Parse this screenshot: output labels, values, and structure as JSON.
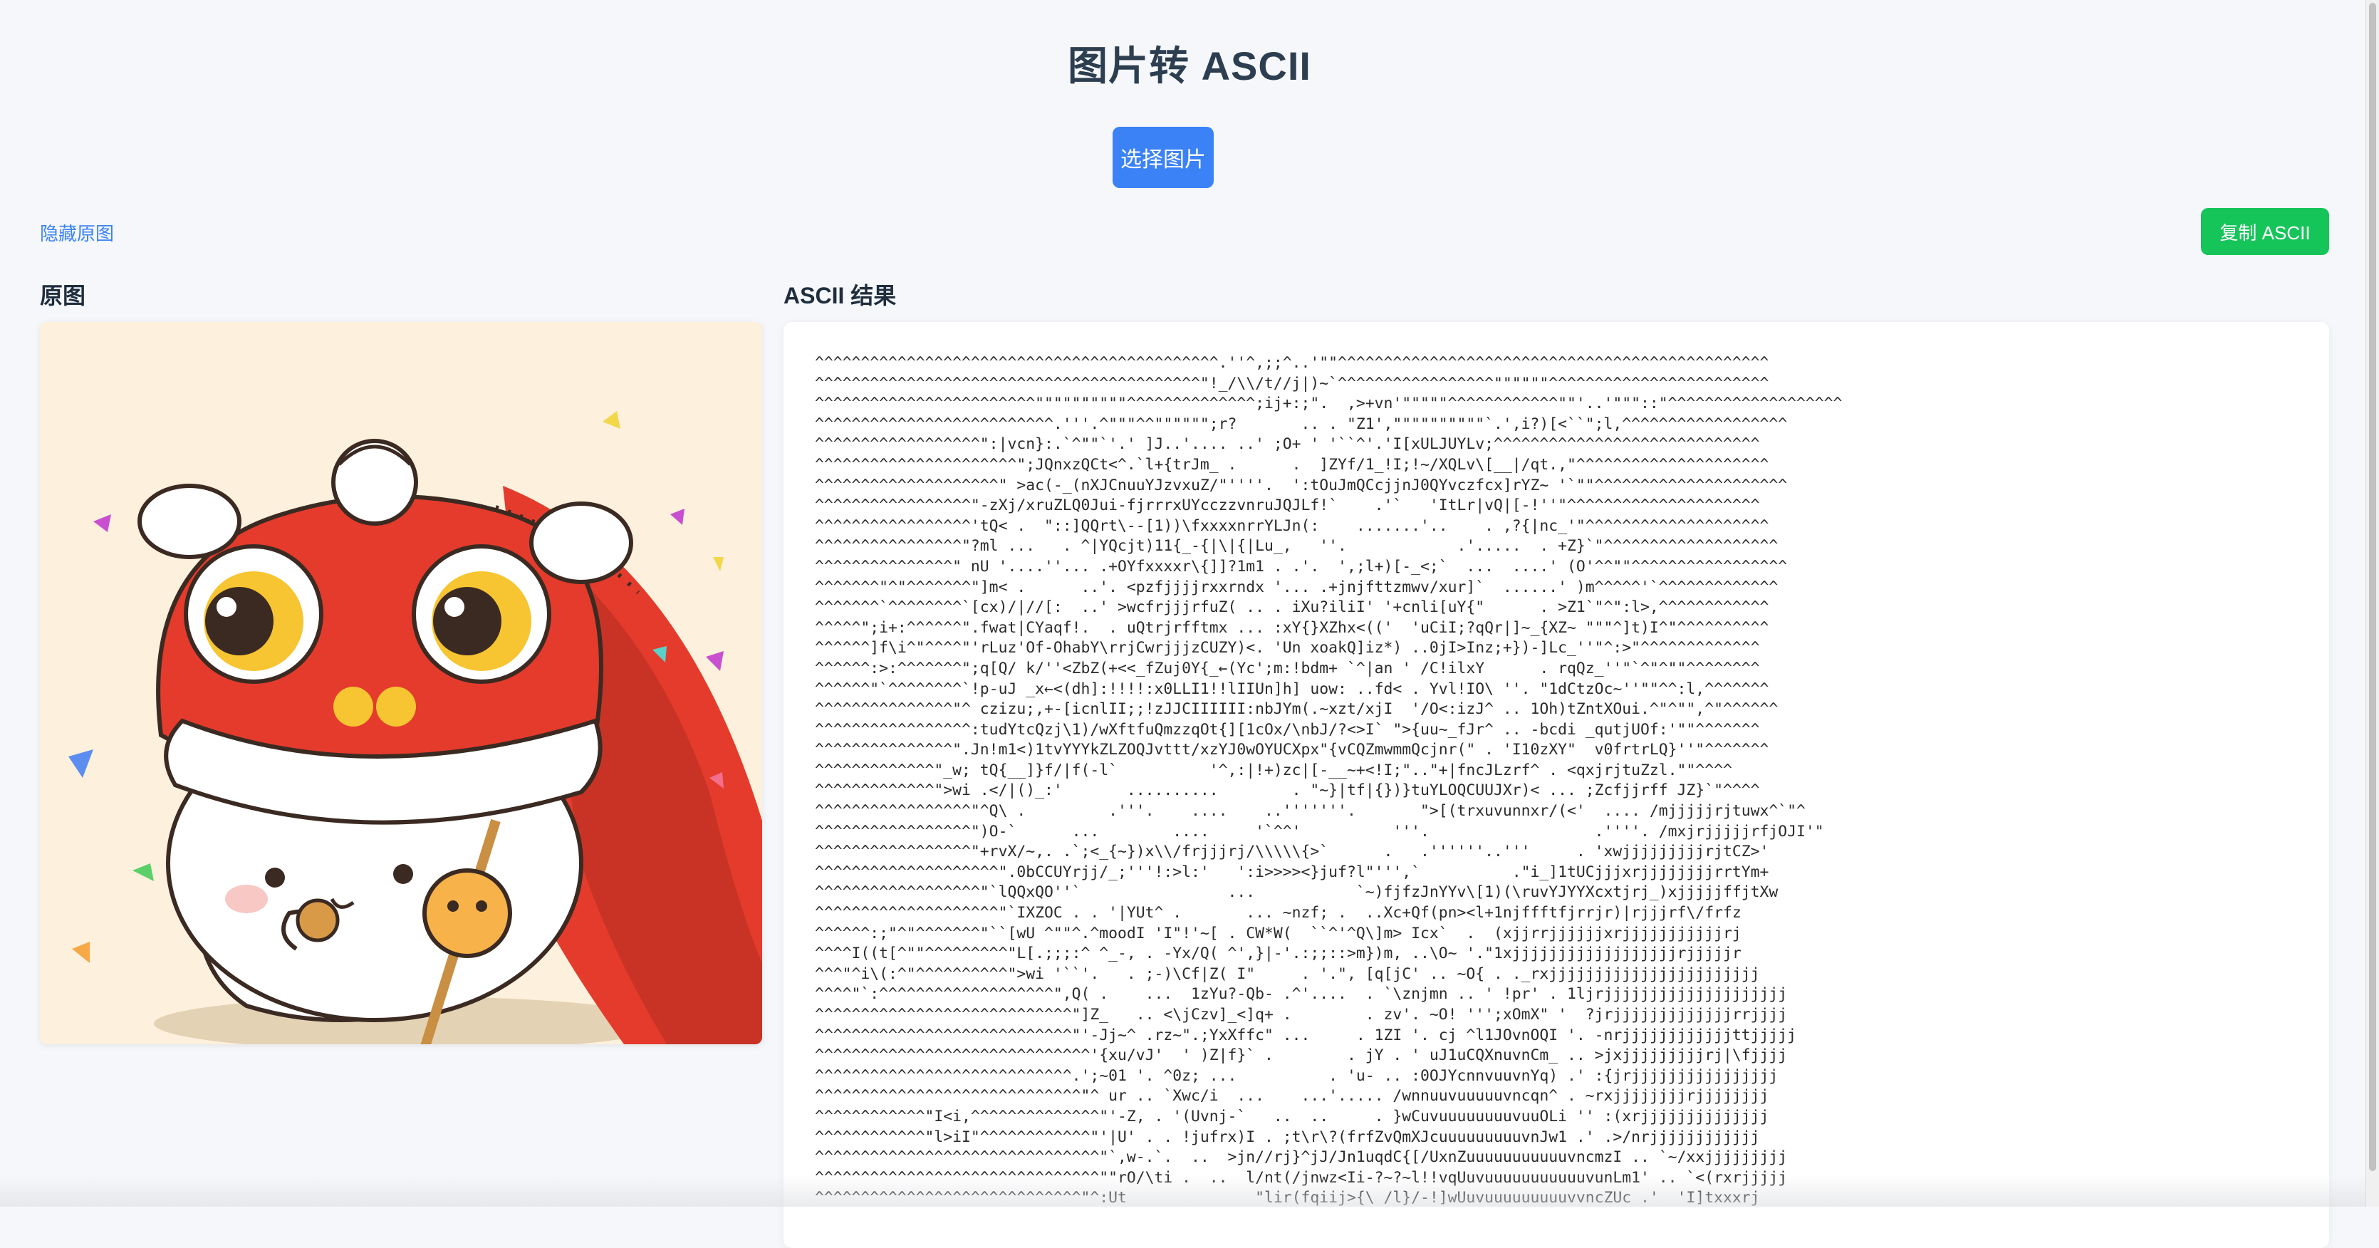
{
  "page": {
    "title": "图片转 ASCII",
    "select_button": "选择图片",
    "toggle_original": "隐藏原图",
    "copy_button": "复制 ASCII"
  },
  "original": {
    "heading": "原图",
    "image_subject": "lion-dance-bunny-illustration"
  },
  "ascii": {
    "heading": "ASCII 结果",
    "text": "^^^^^^^^^^^^^^^^^^^^^^^^^^^^^^^^^^^^^^^^^^^^.''^,;;^..'\"\"^^^^^^^^^^^^^^^^^^^^^^^^^^^^^^^^^^^^^^^^^^^^^^^\n^^^^^^^^^^^^^^^^^^^^^^^^^^^^^^^^^^^^^^^^^^\"!_/\\\\/t//j|)~`^^^^^^^^^^^^^^^^^\"\"\"\"\"\"^^^^^^^^^^^^^^^^^^^^^^^^\n^^^^^^^^^^^^^^^^^^^^^^^^\"\"\"\"\"\"\"\"\"\"^^^^^^^^^^^^^^;ij+:;\".  ,>+vn'\"\"\"\"\"^^^^^^^^^^^^\"\"'..'\"\"\"::\"^^^^^^^^^^^^^^^^^^^\n^^^^^^^^^^^^^^^^^^^^^^^^^^.'''.^\"\"\"^^\"\"\"\"\"\";r?       .. . \"Z1',\"\"\"\"\"\"\"\"\"\"`.',i?)[<``\";l,^^^^^^^^^^^^^^^^^^\n^^^^^^^^^^^^^^^^^^\":|vcn}:.`^\"\"`'.' ]J..'.... ..' ;O+ ' '``^'.'I[xULJUYLv;^^^^^^^^^^^^^^^^^^^^^^^^^^^^^\n^^^^^^^^^^^^^^^^^^^^^^\";JQnxzQCt<^.`l+{trJm_ .      .  ]ZYf/1_!I;!~/XQLv\\[__|/qt.,\"^^^^^^^^^^^^^^^^^^^^^\n^^^^^^^^^^^^^^^^^^^^\" >ac(-_(nXJCnuuYJzvxuZ/\"''''.  ':tOuJmQCcjjnJ0QYvczfcx]rYZ~ '`\"\"^^^^^^^^^^^^^^^^^^^^^\n^^^^^^^^^^^^^^^^^\"-zXj/xruZLQ0Jui-fjrrrxUYcczzvnruJQJLf!`    .'`   'ItLr|vQ|[-!''\"^^^^^^^^^^^^^^^^^^^^^\n^^^^^^^^^^^^^^^^^'tQ< .  \"::]QQrt\\--[1))\\fxxxxnrrYLJn(:    .......'..    . ,?{|nc_'\"^^^^^^^^^^^^^^^^^^^^\n^^^^^^^^^^^^^^^^\"?ml ...   . ^|YQcjt)11{_-{|\\|{|Lu_,   ''.            .'.....  . +Z}`\"^^^^^^^^^^^^^^^^^^^\n^^^^^^^^^^^^^^^\" nU '....''... .+OYfxxxxr\\{]]?1m1 . .'.  ',;l+)[-_<;`  ...  ....' (O'^^\"\"^^^^^^^^^^^^^^^^^\n^^^^^^^\"^\"^^^^^^^\"]m< .      ..'. <pzfjjjjrxxrndx '... .+jnjfttzmwv/xur]`  ......' )m^^^^^'`^^^^^^^^^^^^^\n^^^^^^^`^^^^^^^^`[cx)/|//[:  ..' >wcfrjjjrfuZ( .. . iXu?iliI' '+cnli[uY{\"      . >Z1`\"^\":l>,^^^^^^^^^^^^\n^^^^^\";i+:^^^^^^\".fwat|CYaqf!.  . uQtrjrfftmx ... :xY{}XZhx<(('  'uCiI;?qQr|]~_{XZ~ \"\"\"^]t)I^\"^^^^^^^^^^\n^^^^^^]f\\i^\"^^^^\"'rLuz'Of-OhabY\\rrjCwrjjjzCUZY)<. 'Un xoakQ]iz*) ..0jI>Inz;+})-]Lc_''\"^:>\"^^^^^^^^^^^^^\n^^^^^^:>:^^^^^^^\";q[Q/ k/''<ZbZ(+<<_fZuj0Y{_←(Yc';m:!bdm+ `^|an ' /C!ilxY      . rqQz_''\"`^\"^\"\"^^^^^^^^\n^^^^^^\"`^^^^^^^^`!p-uJ _x←<(dh]:!!!!:x0LLI1!!lIIUn]h] uow: ..fd< . Yvl!IO\\ ''. \"1dCtzOc~''\"\"^^:l,^^^^^^^\n^^^^^^^^^^^^^^^\"^ czizu;,+-[icnlII;;!zJJCIIIIII:nbJYm(.~xzt/xjI  '/O<:izJ^ .. 1Oh)tZntXOui.^\"^\"\",^\"^^^^^^\n^^^^^^^^^^^^^^^^^:tudYtcQzj\\1)/wXftfuQmzzqOt{][1cOx/\\nbJ/?<>I` \">{uu~_fJr^ .. -bcdi _qutjUOf:'\"\"^^^^^^^\n^^^^^^^^^^^^^^^\".Jn!m1<)1tvYYYkZLZOQJvttt/xzYJ0wOYUCXpx\"{vCQZmwmmQcjnr(\" . 'I10zXY\"  v0frtrLQ}''\"^^^^^^^\n^^^^^^^^^^^^^\"_w; tQ{__]}f/|f(-l`          '^,:|!+)zc|[-__~+<!I;\"..\"+|fncJLzrf^ . <qxjrjtuZzl.\"\"^^^^\n^^^^^^^^^^^^^\">wi .</|()_:'       ..........        . \"~}|tf|{})}tuYLOQCUUJXr)< ... ;Zcfjjrff JZ}`\"^^^^\n^^^^^^^^^^^^^^^^^\"^Q\\ .         .'''.    ....    ..'''''''.       \">[(trxuvunnxr/(<'  .... /mjjjjjrjtuwx^`\"^\n^^^^^^^^^^^^^^^^^\")O-`      ...        ....     '`^^'          '''.                  .''''. /mxjrjjjjjrfjOJI'\"\n^^^^^^^^^^^^^^^^^\"+rvX/~,. .`;<_{~})x\\\\/frjjjrj/\\\\\\\\\\{>`      .   .''''''..'''     . 'xwjjjjjjjjjrjtCZ>'\n^^^^^^^^^^^^^^^^^^^^\".0bCCUYrjj/_;'''!:>l:'   ':i>>>><}juf?l\"''',`          .\"i_]1tUCjjjxrjjjjjjjjrrtYm+\n^^^^^^^^^^^^^^^^^^\"`lQQxQO''`                ...           `~)fjfzJnYYv\\[1)(\\ruvYJYYXcxtjrj_)xjjjjjffjtXw\n^^^^^^^^^^^^^^^^^^^^\"`IXZOC . . '|YUt^ .       ... ~nzf; .  ..Xc+Qf(pn><l+1njffftfjrrjr)|rjjjrf\\/frfz\n^^^^^^:;\"^\"^^^^^^^\"``[wU ^\"\"^.^moodI 'I\"!'~[ . CW*W(  ``^'^Q\\]m> Icx`  .  (xjjrrjjjjjjxrjjjjjjjjjjjrj\n^^^^I((t[^\"\"^^^^^^^^^\"L[.;;;:^ ^_-, . -Yx/Q( ^',}|-'.:;;::>m})m, ..\\O~ '.\"1xjjjjjjjjjjjjjjjjjjrjjjjjr\n^^^\"^i\\(:^\"^^^^^^^^^^\">wi '``'.   . ;-)\\Cf|Z( I\"     . '.\", [q[jC' .. ~O{ . ._rxjjjjjjjjjjjjjjjjjjjjjjj\n^^^^\"`:^^^^^^^^^^^^^^^^^^^\",Q( .    ...  1zYu?-Qb- .^'....  . `\\znjmn .. ' !pr' . 1ljrjjjjjjjjjjjjjjjjjjjj\n^^^^^^^^^^^^^^^^^^^^^^^^^^^^\"]Z_   .. <\\jCzv]_<]q+ .        . zv'. ~O! ''';xOmX\" '  ?jrjjjjjjjjjjjjjrrjjjj\n^^^^^^^^^^^^^^^^^^^^^^^^^^^^\"'-Jj~^ .rz~\".;YxXffc\" ...     . 1ZI '. cj ^l1JOvnOQI '. -nrjjjjjjjjjjjjttjjjjj\n^^^^^^^^^^^^^^^^^^^^^^^^^^^^^^'{xu/vJ'  ' )Z|f}` .        . jY . ' uJ1uCQXnuvnCm_ .. >jxjjjjjjjjjrj|\\fjjjj\n^^^^^^^^^^^^^^^^^^^^^^^^^^^^.';~01 '. ^0z; ...          . 'u- .. :0OJYcnnvuuvnYq) .' :{jrjjjjjjjjjjjjjjjj\n^^^^^^^^^^^^^^^^^^^^^^^^^^^^^\"^ ur .. `Xwc/i  ...    ...'..... /wnnuuvuuuuuvncqn^ . ~rxjjjjjjjjrjjjjjjjj\n^^^^^^^^^^^^\"I<i,^^^^^^^^^^^^^^\"'-Z, . '(Uvnj-`   ..  ..     . }wCuvuuuuuuuuvuuOLi '' :(xrjjjjjjjjjjjjjj\n^^^^^^^^^^^^\"l>iI\"^^^^^^^^^^^^\"'|U' . . !jufrx)I . ;t\\r\\?(frfZvQmXJcuuuuuuuuuvnJw1 .' .>/nrjjjjjjjjjjjj\n^^^^^^^^^^^^^^^^^^^^^^^^^^^^^^^\"`,w-.`.  ..  >jn//rj}^jJ/Jn1uqdC{[/UxnZuuuuuuuuuuuvncmzI .. `~/xxjjjjjjjjj\n^^^^^^^^^^^^^^^^^^^^^^^^^^^^^^^\"\"rO/\\ti .  ..  l/nt(/jnwz<Ii-?~?~l!!vqUuvuuuuuuuuuuuvunLm1' .. `<(rxrjjjjj\n^^^^^^^^^^^^^^^^^^^^^^^^^^^^^\"^:Ut              \"lir(fqiij>{\\ /l}/-!]wUuvuuuuuuuuuvvncZUc .'  'I]txxxrj"
  }
}
